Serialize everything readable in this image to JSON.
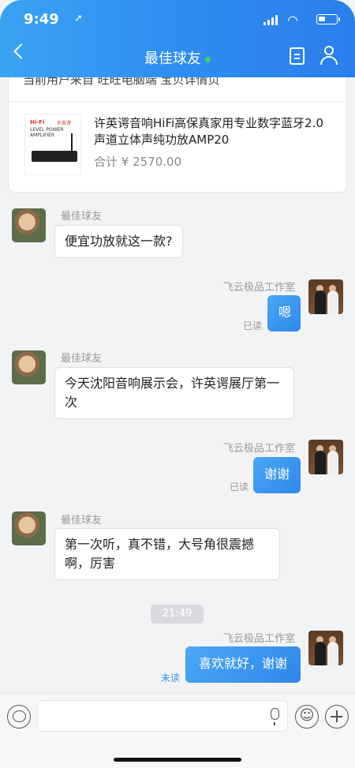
{
  "status_bar": {
    "time": "9:49"
  },
  "header": {
    "title": "最佳球友"
  },
  "product_card": {
    "header_text": "当前用户来自 旺旺电脑端 宝贝详情页",
    "image_text": {
      "line1": "Hi-Fi",
      "line2": "LEVEL POWER AMPLIFIER",
      "brand": "许英谔"
    },
    "name": "许英谔音响HiFi高保真家用专业数字蓝牙2.0声道立体声纯功放AMP20",
    "price": "合计 ¥ 2570.00"
  },
  "messages": [
    {
      "side": "left",
      "sender": "最佳球友",
      "text": "便宜功放就这一款?"
    },
    {
      "side": "right",
      "sender": "飞云极品工作室",
      "text": "嗯",
      "status": "已读"
    },
    {
      "side": "left",
      "sender": "最佳球友",
      "text": "今天沈阳音响展示会，许英谔展厅第一次"
    },
    {
      "side": "right",
      "sender": "飞云极品工作室",
      "text": "谢谢",
      "status": "已读"
    },
    {
      "side": "left",
      "sender": "最佳球友",
      "text": "第一次听，真不错，大号角很震撼啊，厉害"
    },
    {
      "side": "right",
      "sender": "飞云极品工作室",
      "text": "喜欢就好，谢谢",
      "status": "未读"
    }
  ],
  "timestamp": "21:49",
  "input_bar": {
    "emoji_glyph": "☺"
  }
}
